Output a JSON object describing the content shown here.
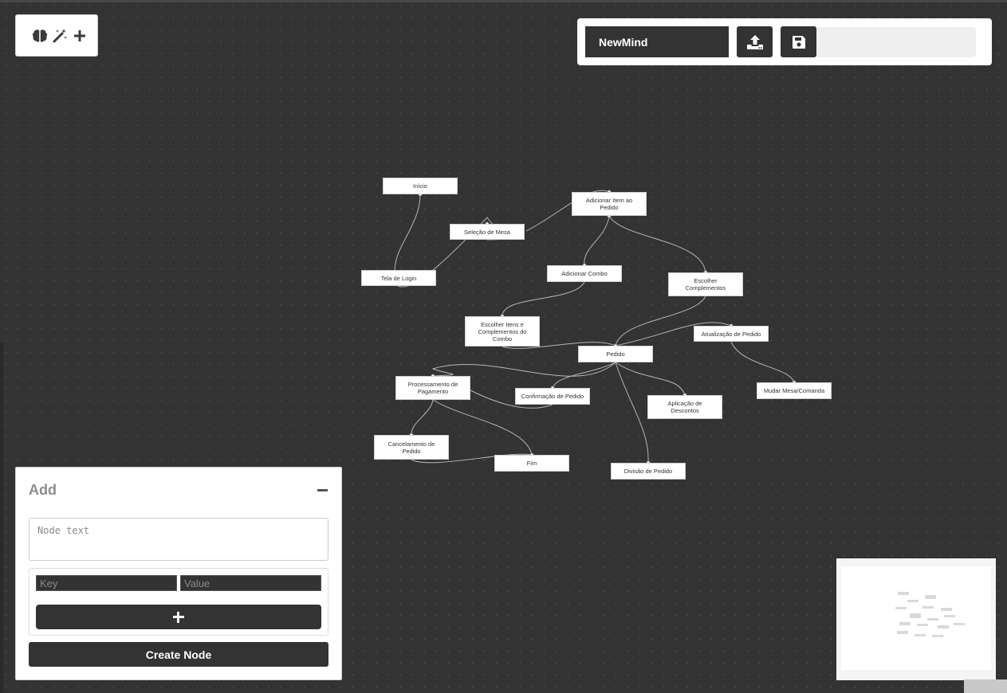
{
  "toolbox": {
    "icons": [
      "brain-icon",
      "magic-wand-icon",
      "plus-icon"
    ]
  },
  "topbar": {
    "map_name": "NewMind",
    "upload_icon": "upload-icon",
    "save_icon": "floppy-disk-icon",
    "progress": 0
  },
  "nodes": [
    {
      "id": "inicio",
      "label": "Início"
    },
    {
      "id": "adicionar-item",
      "label": "Adicionar Item ao Pedido"
    },
    {
      "id": "selecao-mesa",
      "label": "Seleção de Mesa"
    },
    {
      "id": "tela-login",
      "label": "Tela de Login"
    },
    {
      "id": "adicionar-combo",
      "label": "Adicionar Combo"
    },
    {
      "id": "escolher-complementos",
      "label": "Escolher Complementos"
    },
    {
      "id": "escolher-itens-combo",
      "label": "Escolher Itens e Complementos do Combo"
    },
    {
      "id": "atualizacao-pedido",
      "label": "Atualização de Pedido"
    },
    {
      "id": "pedido",
      "label": "Pedido"
    },
    {
      "id": "processamento-pagamento",
      "label": "Processamento de Pagamento"
    },
    {
      "id": "confirmacao-pedido",
      "label": "Confirmação de Pedido"
    },
    {
      "id": "mudar-mesa",
      "label": "Mudar Mesa/Comanda"
    },
    {
      "id": "aplicacao-descontos",
      "label": "Aplicação de Descontos"
    },
    {
      "id": "cancelamento-pedido",
      "label": "Cancelamento de Pedido"
    },
    {
      "id": "fim",
      "label": "Fim"
    },
    {
      "id": "divisao-pedido",
      "label": "Divisão de Pedido"
    }
  ],
  "add_panel": {
    "title": "Add",
    "collapse_icon": "minus-icon",
    "node_text_placeholder": "Node text",
    "key_placeholder": "Key",
    "value_placeholder": "Value",
    "add_field_icon": "plus-icon",
    "create_label": "Create Node"
  },
  "colors": {
    "canvas": "#333333",
    "grid_dot": "#4a4a4a",
    "node_bg": "#ffffff",
    "edge": "#b5b5b5",
    "button_dark": "#333333"
  }
}
